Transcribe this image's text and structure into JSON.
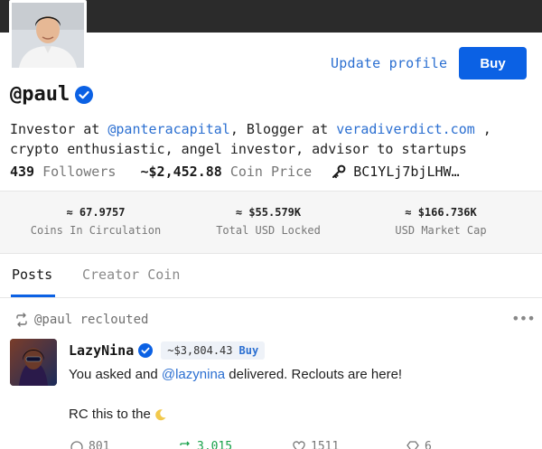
{
  "profile": {
    "username": "@paul",
    "update_label": "Update profile",
    "buy_label": "Buy",
    "bio_line1_prefix": "Investor at ",
    "bio_link1": "@panteracapital",
    "bio_line1_mid": ", Blogger at ",
    "bio_link2": "veradiverdict.com",
    "bio_line1_suffix": " ,",
    "bio_line2": "crypto enthusiastic, angel investor, advisor to startups",
    "followers_count": "439",
    "followers_label": "Followers",
    "coin_price": "~$2,452.88",
    "coin_price_label": "Coin Price",
    "public_key": "BC1YLj7bjLHW…"
  },
  "metrics": [
    {
      "value": "≈ 67.9757",
      "label": "Coins In Circulation"
    },
    {
      "value": "≈ $55.579K",
      "label": "Total USD Locked"
    },
    {
      "value": "≈ $166.736K",
      "label": "USD Market Cap"
    }
  ],
  "tabs": {
    "posts": "Posts",
    "creator_coin": "Creator Coin"
  },
  "post": {
    "recloute_text": "@paul reclouted",
    "more": "•••",
    "author": "LazyNina",
    "price": "~$3,804.43",
    "price_buy": "Buy",
    "body_prefix": "You asked and ",
    "body_mention": "@lazynina",
    "body_suffix": " delivered. Reclouts are here!",
    "line2": "RC this to the",
    "actions": {
      "comments": "801",
      "reclouts": "3,015",
      "likes": "1511",
      "diamonds": "6"
    }
  },
  "colors": {
    "accent": "#0b61e4",
    "link": "#2b6fd1",
    "banner": "#2b2b2b"
  }
}
